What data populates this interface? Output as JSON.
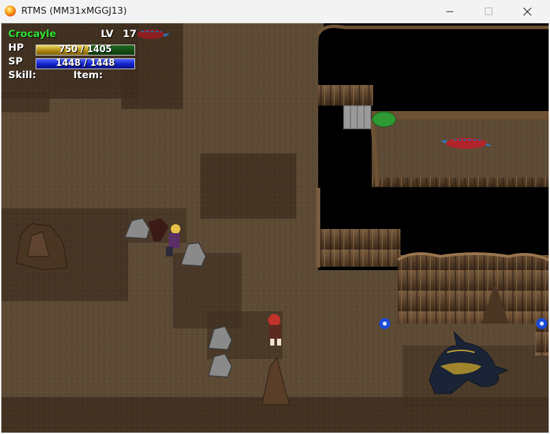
{
  "window": {
    "title": "RTMS (MM31xMGGJ13)"
  },
  "hud": {
    "name": "Crocayle",
    "lv_label": "LV",
    "lv_value": "17",
    "hp_label": "HP",
    "hp_text": "750 / 1405",
    "hp_fraction": 0.534,
    "sp_label": "SP",
    "sp_text": "1448 / 1448",
    "sp_fraction": 1.0,
    "skill_label": "Skill:",
    "item_label": "Item:"
  },
  "colors": {
    "name": "#33e233",
    "hp_bar": "#c9a21e",
    "sp_bar": "#1a2ee0",
    "cave_floor": "#5d4a35",
    "void": "#000000"
  }
}
